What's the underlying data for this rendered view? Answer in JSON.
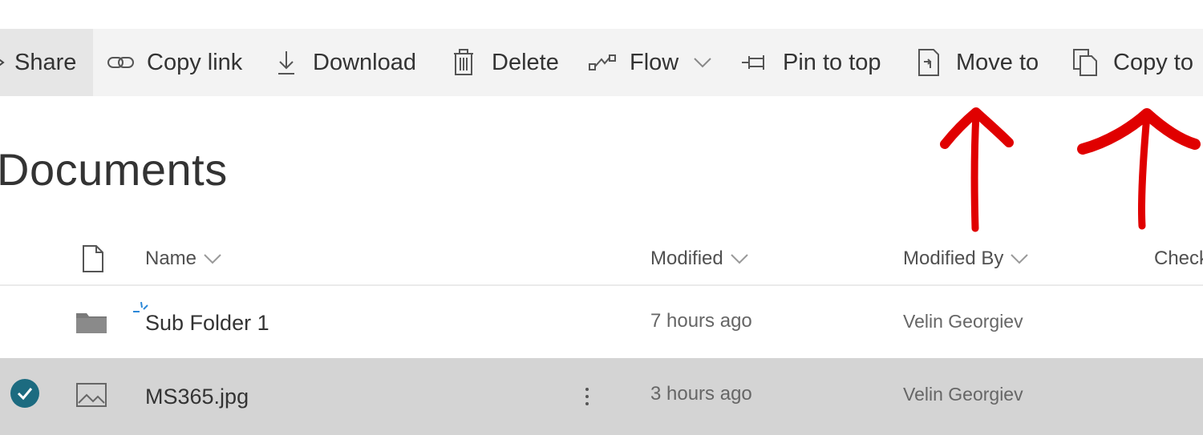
{
  "command_bar": {
    "share_label": "Share",
    "copy_link_label": "Copy link",
    "download_label": "Download",
    "delete_label": "Delete",
    "flow_label": "Flow",
    "pin_label": "Pin to top",
    "move_label": "Move to",
    "copy_to_label": "Copy to"
  },
  "page_title": "Documents",
  "columns": {
    "name": "Name",
    "modified": "Modified",
    "modified_by": "Modified By",
    "checked_out": "Check"
  },
  "rows": [
    {
      "name": "Sub Folder 1",
      "modified": "7 hours ago",
      "modified_by": "Velin Georgiev",
      "type": "folder-icon",
      "selected": false
    },
    {
      "name": "MS365.jpg",
      "modified": "3 hours ago",
      "modified_by": "Velin Georgiev",
      "type": "image-file-icon",
      "selected": true
    }
  ],
  "colors": {
    "command_bar_bg": "#f3f3f3",
    "selected_row_bg": "#d4d4d4",
    "check_accent": "#1c6b80",
    "annotation_arrow": "#e00000"
  }
}
